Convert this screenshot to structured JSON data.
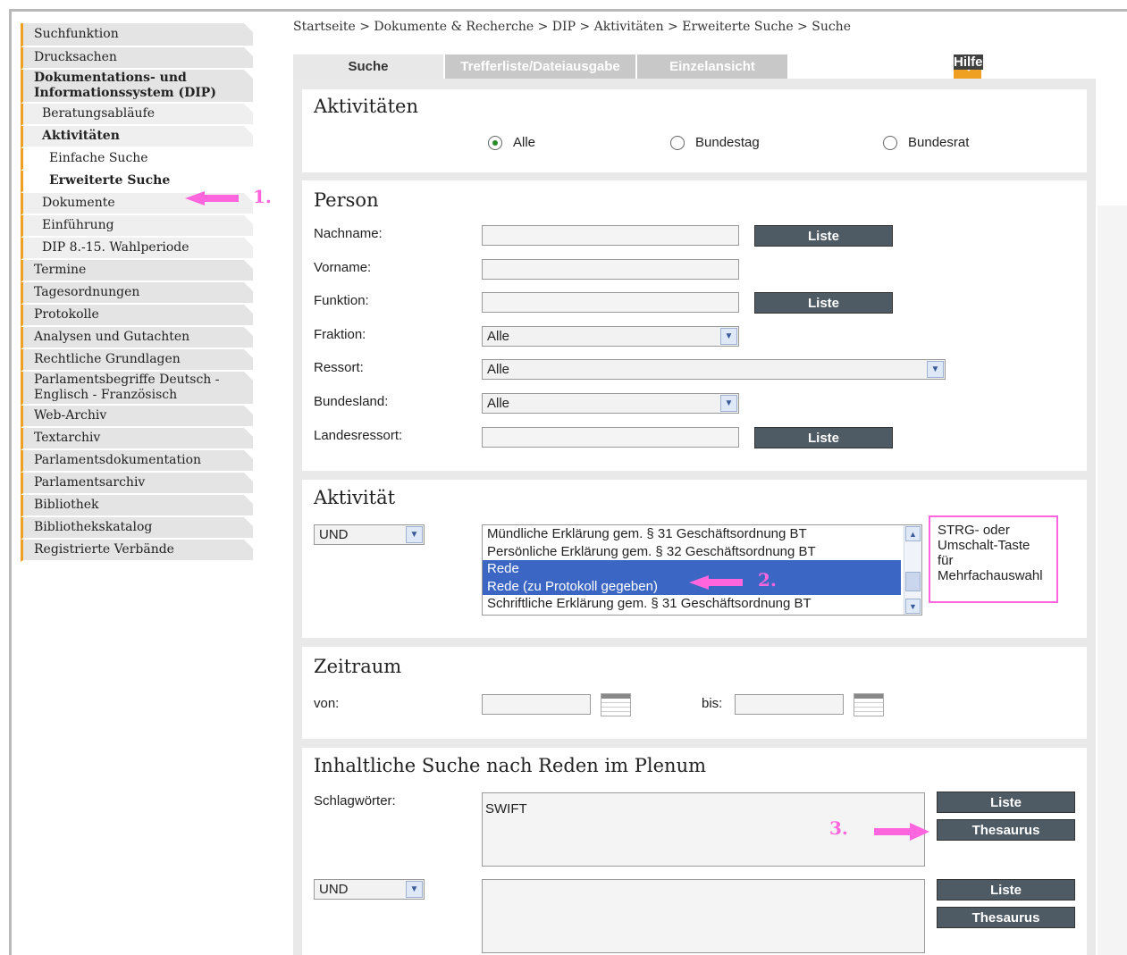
{
  "sidebar": {
    "items": [
      {
        "label": "Suchfunktion"
      },
      {
        "label": "Drucksachen"
      },
      {
        "label": "Dokumentations- und Informationssystem (DIP)"
      },
      {
        "label": "Beratungsabläufe"
      },
      {
        "label": "Aktivitäten"
      },
      {
        "label": "Einfache Suche"
      },
      {
        "label": "Erweiterte Suche"
      },
      {
        "label": "Dokumente"
      },
      {
        "label": "Einführung"
      },
      {
        "label": "DIP 8.-15. Wahlperiode"
      },
      {
        "label": "Termine"
      },
      {
        "label": "Tagesordnungen"
      },
      {
        "label": "Protokolle"
      },
      {
        "label": "Analysen und Gutachten"
      },
      {
        "label": "Rechtliche Grundlagen"
      },
      {
        "label": "Parlamentsbegriffe Deutsch - Englisch - Französisch"
      },
      {
        "label": "Web-Archiv"
      },
      {
        "label": "Textarchiv"
      },
      {
        "label": "Parlamentsdokumentation"
      },
      {
        "label": "Parlamentsarchiv"
      },
      {
        "label": "Bibliothek"
      },
      {
        "label": "Bibliothekskatalog"
      },
      {
        "label": "Registrierte Verbände"
      }
    ]
  },
  "annotations": {
    "one": "1.",
    "two": "2.",
    "three": "3."
  },
  "breadcrumb": "Startseite > Dokumente & Recherche > DIP > Aktivitäten > Erweiterte Suche > Suche",
  "tabs": [
    "Suche",
    "Trefferliste/Dateiausgabe",
    "Einzelansicht"
  ],
  "help": {
    "label": "Hilfe",
    "icon": "arrow-right-icon"
  },
  "aktivitaeten": {
    "title": "Aktivitäten",
    "options": [
      "Alle",
      "Bundestag",
      "Bundesrat"
    ],
    "selected": "Alle"
  },
  "person": {
    "title": "Person",
    "nachname": "Nachname:",
    "vorname": "Vorname:",
    "funktion": "Funktion:",
    "fraktion": "Fraktion:",
    "ressort": "Ressort:",
    "bundesland": "Bundesland:",
    "landesressort": "Landesressort:",
    "liste": "Liste",
    "fraktion_value": "Alle",
    "ressort_value": "Alle",
    "bundesland_value": "Alle"
  },
  "aktivitaet": {
    "title": "Aktivität",
    "operator": "UND",
    "items": [
      "Mündliche Erklärung gem. § 31 Geschäftsordnung BT",
      "Persönliche Erklärung gem. § 32 Geschäftsordnung BT",
      "Rede",
      "Rede (zu Protokoll gegeben)",
      "Schriftliche Erklärung gem. § 31 Geschäftsordnung BT"
    ],
    "hint_line1": "STRG- oder",
    "hint_line2": "Umschalt-Taste",
    "hint_line3": "für",
    "hint_line4": "Mehrfachauswahl"
  },
  "zeitraum": {
    "title": "Zeitraum",
    "von": "von:",
    "bis": "bis:"
  },
  "inhalt": {
    "title": "Inhaltliche Suche nach Reden im Plenum",
    "schlagwoerter": "Schlagwörter:",
    "value": "SWIFT",
    "liste": "Liste",
    "thesaurus": "Thesaurus",
    "operator": "UND"
  }
}
